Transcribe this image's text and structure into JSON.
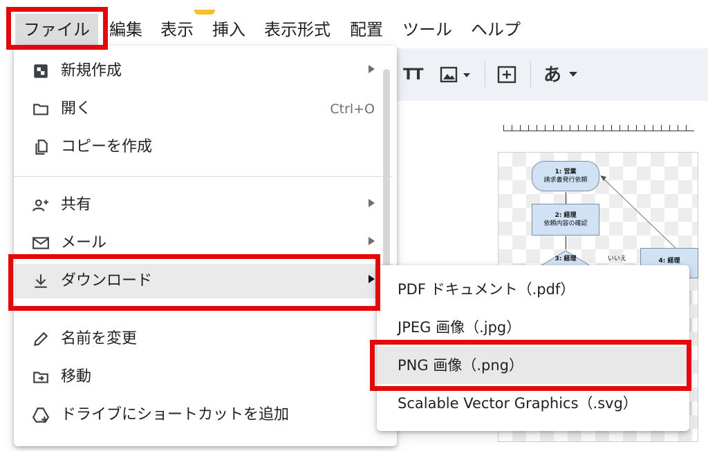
{
  "menubar": {
    "items": [
      "ファイル",
      "編集",
      "表示",
      "挿入",
      "表示形式",
      "配置",
      "ツール",
      "ヘルプ"
    ]
  },
  "toolbar": {
    "text_icon_label": "TT",
    "font_button_label": "あ"
  },
  "flowchart": {
    "nodes": [
      {
        "title": "1: 営業",
        "text": "請求書発行依頼"
      },
      {
        "title": "2: 経理",
        "text": "依頼内容の確認"
      },
      {
        "title": "3: 経理",
        "text": ""
      },
      {
        "title": "4: 経理",
        "text": ""
      }
    ],
    "edge_label": "いいえ"
  },
  "file_menu": {
    "items": [
      {
        "icon": "new-document-icon",
        "label": "新規作成",
        "submenu": true
      },
      {
        "icon": "folder-icon",
        "label": "開く",
        "shortcut": "Ctrl+O"
      },
      {
        "icon": "copy-icon",
        "label": "コピーを作成"
      },
      {
        "icon": "add-person-icon",
        "label": "共有",
        "submenu": true
      },
      {
        "icon": "mail-icon",
        "label": "メール",
        "submenu": true
      },
      {
        "icon": "download-icon",
        "label": "ダウンロード",
        "submenu": true,
        "highlighted": true
      },
      {
        "icon": "pencil-icon",
        "label": "名前を変更"
      },
      {
        "icon": "move-folder-icon",
        "label": "移動"
      },
      {
        "icon": "drive-shortcut-icon",
        "label": "ドライブにショートカットを追加"
      }
    ]
  },
  "download_submenu": {
    "items": [
      {
        "label": "PDF ドキュメント（.pdf）"
      },
      {
        "label": "JPEG 画像（.jpg）"
      },
      {
        "label": "PNG 画像（.png）",
        "highlighted": true
      },
      {
        "label": "Scalable Vector Graphics（.svg）"
      }
    ]
  },
  "colors": {
    "highlight_box": "#e4080a",
    "menu_hover": "#eaeaea",
    "yellow_accent": "#f6c026",
    "flow_node_fill": "#d2e2f5"
  }
}
